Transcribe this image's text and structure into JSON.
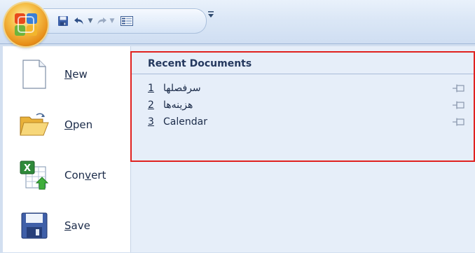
{
  "quick_access": {
    "icons": [
      "save-icon",
      "undo-icon",
      "undo-dropdown-icon",
      "redo-icon",
      "redo-dropdown-icon",
      "form-icon",
      "customize-qat-icon"
    ]
  },
  "office_button": {
    "icon": "office-logo-icon"
  },
  "commands": [
    {
      "label_prefix": "",
      "label_key": "N",
      "label_rest": "ew",
      "icon": "new-document-icon"
    },
    {
      "label_prefix": "",
      "label_key": "O",
      "label_rest": "pen",
      "icon": "open-folder-icon"
    },
    {
      "label_prefix": "Con",
      "label_key": "v",
      "label_rest": "ert",
      "icon": "convert-icon"
    },
    {
      "label_prefix": "",
      "label_key": "S",
      "label_rest": "ave",
      "icon": "save-disk-icon"
    }
  ],
  "recent": {
    "title": "Recent Documents",
    "items": [
      {
        "number": "1",
        "name": "سرفصلها"
      },
      {
        "number": "2",
        "name": "هزینه‌ها"
      },
      {
        "number": "3",
        "name": "Calendar"
      }
    ]
  },
  "colors": {
    "highlight": "#e0211f",
    "panel": "#e6eef9",
    "frame": "#d2dff0"
  }
}
